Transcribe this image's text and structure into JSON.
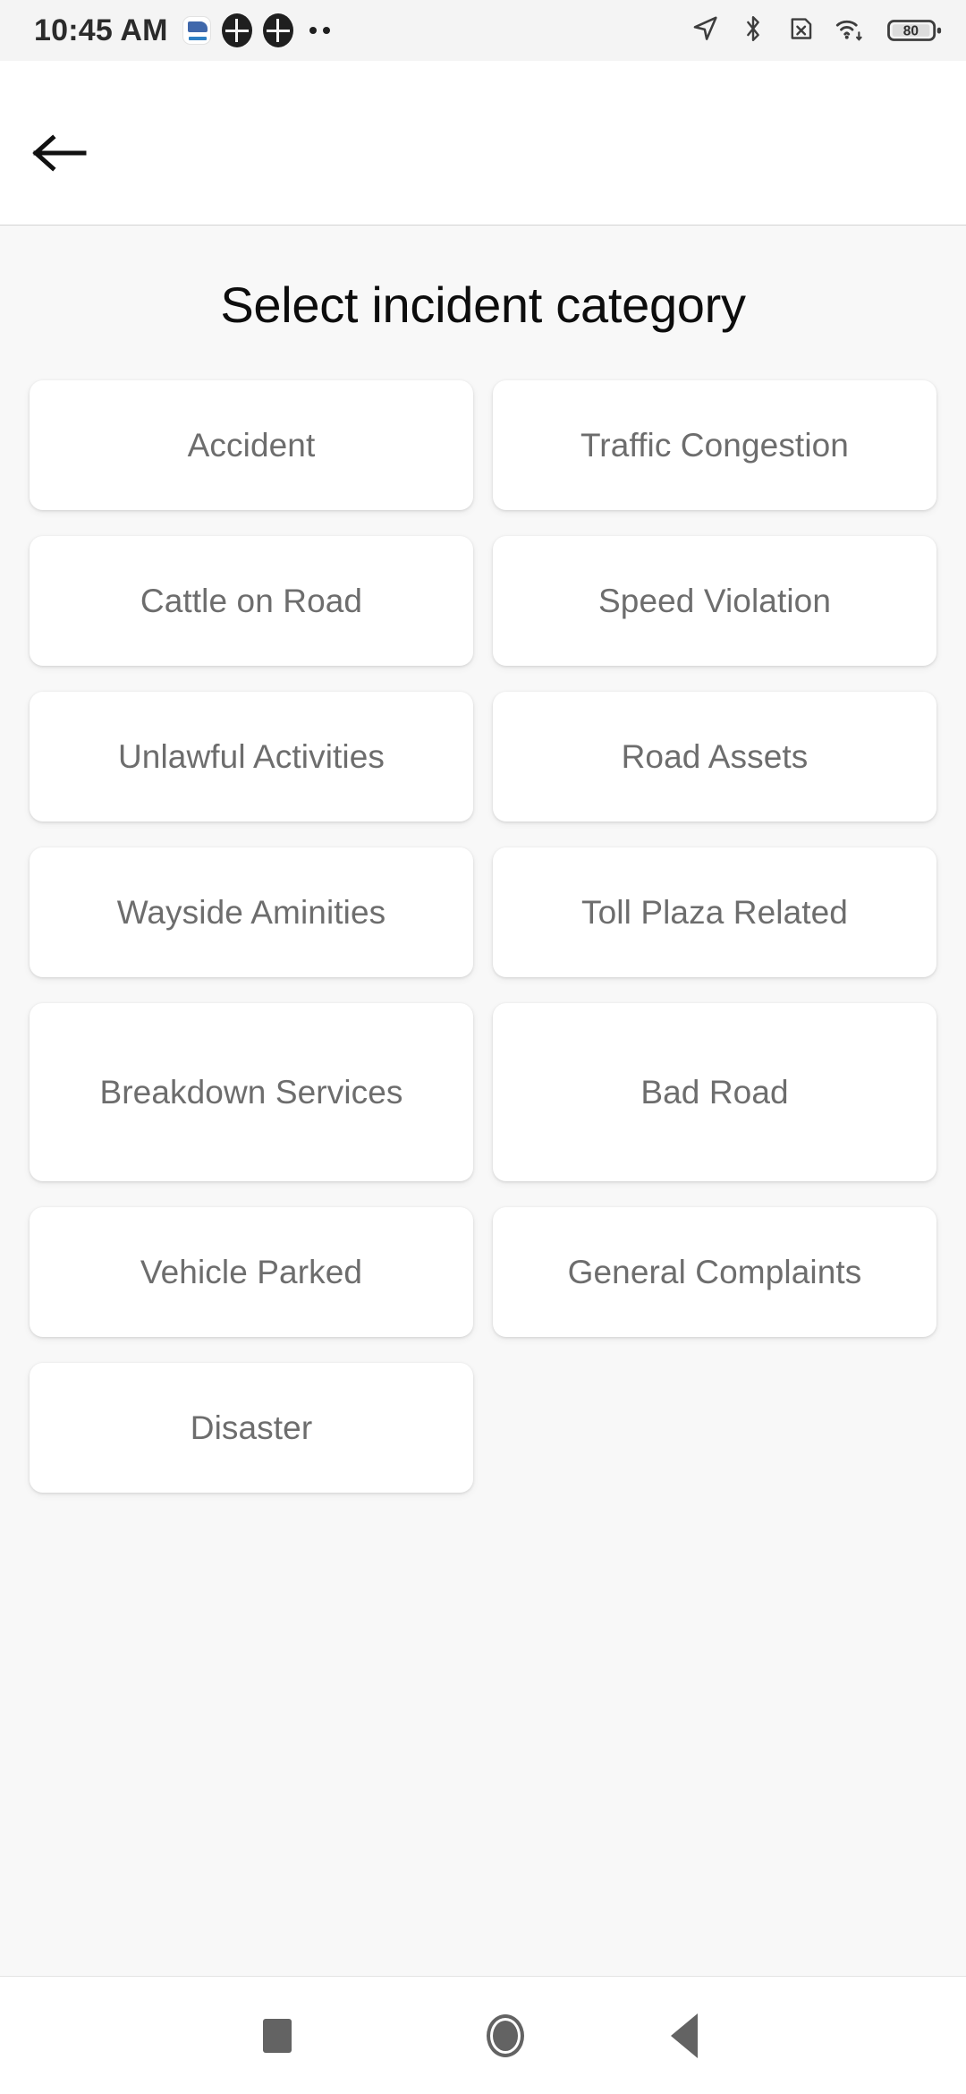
{
  "status_bar": {
    "time": "10:45 AM",
    "left_icons": [
      "app-logo-badge",
      "notification-circle-icon",
      "notification-circle-icon",
      "more-dots-icon"
    ],
    "right_icons": [
      "location-arrow-icon",
      "bluetooth-icon",
      "no-sim-icon",
      "wifi-icon"
    ],
    "battery_level": "80"
  },
  "app_bar": {
    "back_label": "back-arrow"
  },
  "main": {
    "title": "Select incident category",
    "categories": [
      {
        "label": "Accident",
        "tall": false
      },
      {
        "label": "Traffic Congestion",
        "tall": false
      },
      {
        "label": "Cattle on Road",
        "tall": false
      },
      {
        "label": "Speed Violation",
        "tall": false
      },
      {
        "label": "Unlawful Activities",
        "tall": false
      },
      {
        "label": "Road Assets",
        "tall": false
      },
      {
        "label": "Wayside Aminities",
        "tall": false
      },
      {
        "label": "Toll Plaza Related",
        "tall": false
      },
      {
        "label": "Breakdown Services",
        "tall": true
      },
      {
        "label": "Bad Road",
        "tall": true
      },
      {
        "label": "Vehicle Parked",
        "tall": false
      },
      {
        "label": "General Complaints",
        "tall": false
      },
      {
        "label": "Disaster",
        "tall": false
      }
    ]
  },
  "nav_bar": {
    "recents_label": "recents-button",
    "home_label": "home-button",
    "back_label": "back-button"
  },
  "colors": {
    "page_bg": "#f8f8f8",
    "card_bg": "#ffffff",
    "card_text": "#6d6d6d",
    "title_text": "#0d0d0d",
    "status_bg": "#f4f4f4",
    "nav_icon": "#636363"
  }
}
